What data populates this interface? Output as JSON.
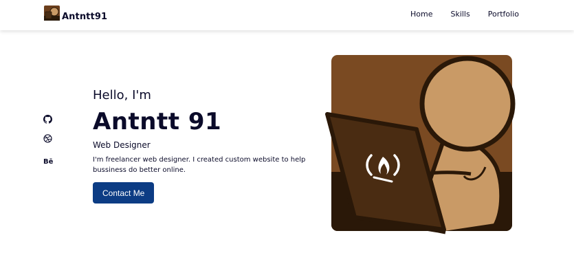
{
  "header": {
    "brand": "Antntt91",
    "logo_icon": "portrait-avatar-icon",
    "nav": [
      {
        "label": "Home"
      },
      {
        "label": "Skills"
      },
      {
        "label": "Portfolio"
      }
    ]
  },
  "social": [
    {
      "icon": "github-icon"
    },
    {
      "icon": "dribbble-icon"
    },
    {
      "icon": "behance-icon",
      "label": "Bē"
    }
  ],
  "hero": {
    "greeting": "Hello, I'm",
    "name": "Antntt 91",
    "role": "Web Designer",
    "description": "I'm freelancer web designer. I created custom website to help bussiness do better online.",
    "cta_label": "Contact Me",
    "illustration_icon": "person-with-laptop-illustration"
  },
  "colors": {
    "accent": "#0c3c84",
    "text": "#0b0b2a",
    "illustration_bg": "#7a4a22",
    "illustration_skin": "#c99a66"
  }
}
